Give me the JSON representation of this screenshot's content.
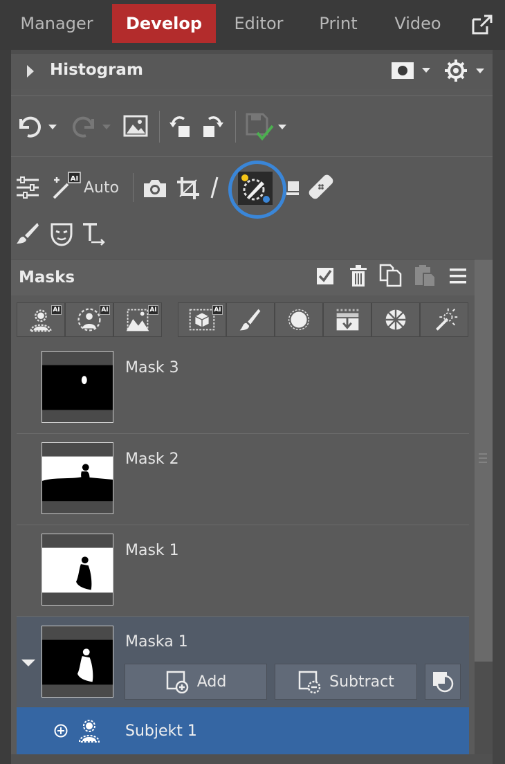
{
  "tabs": [
    {
      "label": "Manager",
      "active": false
    },
    {
      "label": "Develop",
      "active": true
    },
    {
      "label": "Editor",
      "active": false
    },
    {
      "label": "Print",
      "active": false
    },
    {
      "label": "Video",
      "active": false
    }
  ],
  "histogram": {
    "title": "Histogram"
  },
  "toolbar": {
    "history_icons": [
      "undo-icon",
      "redo-icon",
      "image-compare-icon",
      "rotate-left-icon",
      "rotate-right-icon",
      "save-icon"
    ],
    "develop_icons": [
      "adjustments-icon",
      "auto-enhance-icon",
      "camera-icon",
      "crop-icon",
      "straighten-icon",
      "mask-tool-icon",
      "filter-icon",
      "healing-icon"
    ],
    "auto_label": "Auto",
    "extra_icons": [
      "brush-icon",
      "face-mask-icon",
      "text-icon"
    ]
  },
  "masks": {
    "title": "Masks",
    "header_icons": [
      "checkmark-icon",
      "trash-icon",
      "copy-icon",
      "paste-icon",
      "menu-icon"
    ],
    "tool_buttons": [
      {
        "icon": "ai-person-icon",
        "ai": "AI"
      },
      {
        "icon": "ai-subject-icon",
        "ai": "AI"
      },
      {
        "icon": "ai-landscape-icon",
        "ai": "AI"
      },
      {
        "icon": "ai-object-icon",
        "ai": "AI"
      },
      {
        "icon": "brush-icon",
        "ai": ""
      },
      {
        "icon": "radial-icon",
        "ai": ""
      },
      {
        "icon": "gradient-icon",
        "ai": ""
      },
      {
        "icon": "color-range-icon",
        "ai": ""
      },
      {
        "icon": "magic-wand-icon",
        "ai": ""
      }
    ],
    "items": [
      {
        "name": "Mask 3"
      },
      {
        "name": "Mask 2"
      },
      {
        "name": "Mask 1"
      }
    ],
    "selected": {
      "name": "Maska 1",
      "add_label": "Add",
      "subtract_label": "Subtract"
    },
    "subitem": {
      "name": "Subjekt 1"
    }
  },
  "colors": {
    "active_tab": "#b32c2c",
    "highlight_ring": "#3a86d8",
    "selected_subitem": "#3566a3",
    "selected_group": "#525b68",
    "save_check": "#4caf50"
  }
}
